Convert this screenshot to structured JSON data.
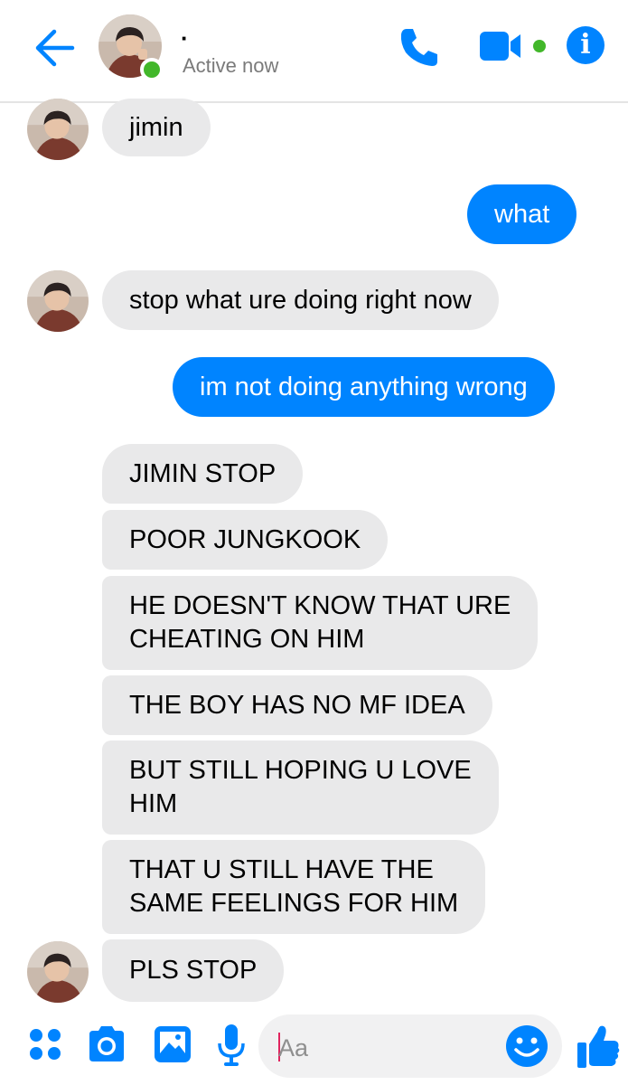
{
  "header": {
    "contact_name": "·",
    "status": "Active now",
    "accent_color": "#0084ff",
    "online_color": "#42b72a"
  },
  "messages": [
    {
      "side": "in",
      "text": "jimin"
    },
    {
      "side": "out",
      "text": "what"
    },
    {
      "side": "in",
      "text": "stop what ure doing right now"
    },
    {
      "side": "out",
      "text": "im not doing anything wrong"
    },
    {
      "side": "in",
      "text": "JIMIN STOP"
    },
    {
      "side": "in",
      "text": "POOR JUNGKOOK"
    },
    {
      "side": "in",
      "text": "HE DOESN'T KNOW THAT URE CHEATING ON HIM",
      "lines": [
        "HE DOESN'T KNOW THAT URE",
        "CHEATING ON HIM"
      ]
    },
    {
      "side": "in",
      "text": "THE BOY HAS NO MF IDEA"
    },
    {
      "side": "in",
      "text": "BUT STILL HOPING U LOVE HIM",
      "lines": [
        "BUT STILL HOPING U LOVE",
        "HIM"
      ]
    },
    {
      "side": "in",
      "text": "THAT U STILL HAVE THE SAME FEELINGS FOR HIM",
      "lines": [
        "THAT U STILL HAVE THE",
        "SAME FEELINGS FOR HIM"
      ]
    },
    {
      "side": "in",
      "text": "PLS STOP"
    }
  ],
  "composer": {
    "placeholder": "Aa",
    "icons": [
      "apps-icon",
      "camera-icon",
      "gallery-icon",
      "microphone-icon",
      "emoji-icon",
      "thumbs-up-icon"
    ]
  }
}
